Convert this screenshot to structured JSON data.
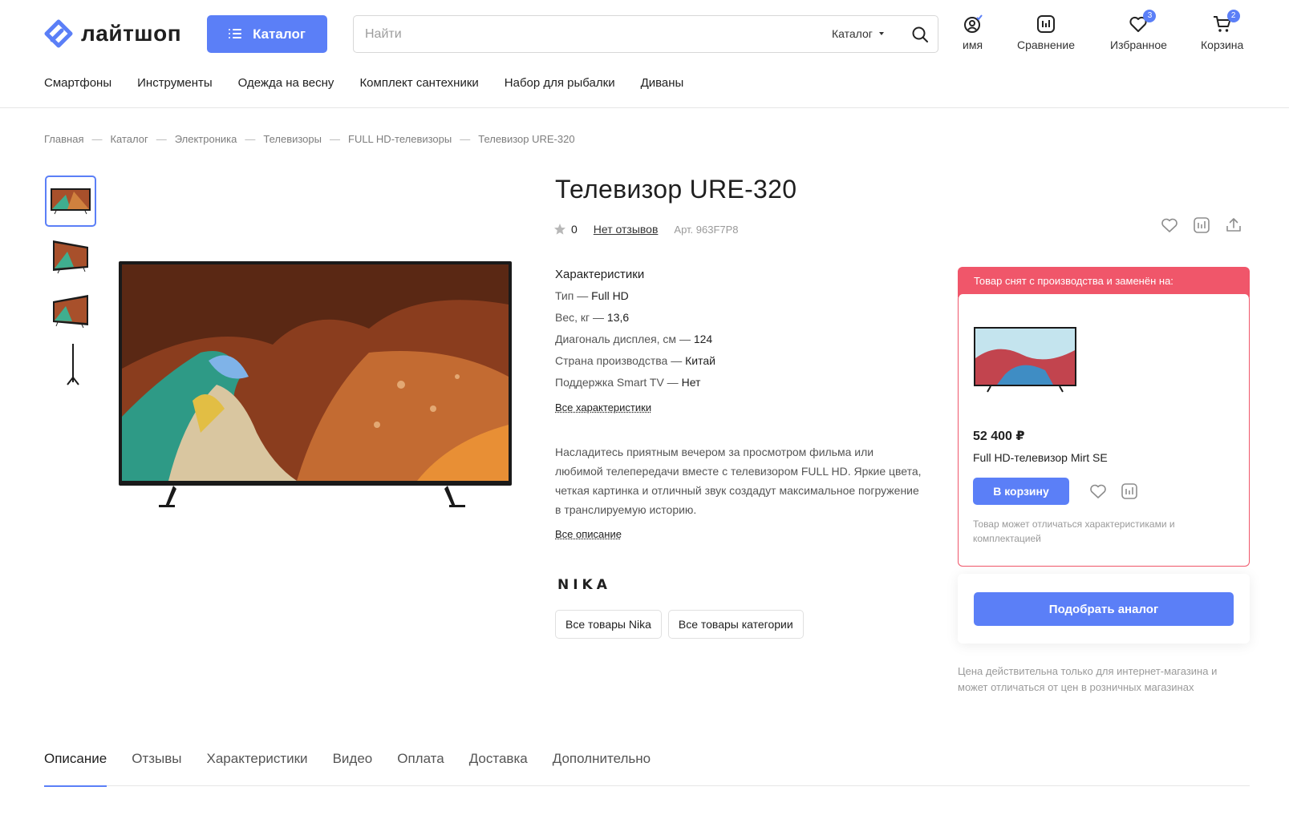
{
  "header": {
    "logo_text": "лайтшоп",
    "catalog_label": "Каталог",
    "search_placeholder": "Найти",
    "search_scope": "Каталог",
    "icons": [
      {
        "label": "имя",
        "icon": "user-icon"
      },
      {
        "label": "Сравнение",
        "icon": "compare-icon"
      },
      {
        "label": "Избранное",
        "icon": "heart-icon",
        "badge": "3"
      },
      {
        "label": "Корзина",
        "icon": "cart-icon",
        "badge": "2"
      }
    ],
    "nav": [
      "Смартфоны",
      "Инструменты",
      "Одежда на весну",
      "Комплект сантехники",
      "Набор для рыбалки",
      "Диваны"
    ]
  },
  "breadcrumb": [
    "Главная",
    "Каталог",
    "Электроника",
    "Телевизоры",
    "FULL HD-телевизоры",
    "Телевизор URE-320"
  ],
  "product": {
    "title": "Телевизор URE-320",
    "rating": "0",
    "reviews_label": "Нет отзывов",
    "sku": "Арт. 963F7P8",
    "specs_heading": "Характеристики",
    "specs": [
      {
        "name": "Тип — ",
        "value": "Full HD"
      },
      {
        "name": "Вес, кг — ",
        "value": "13,6"
      },
      {
        "name": "Диагональ дисплея, см — ",
        "value": "124"
      },
      {
        "name": "Страна производства — ",
        "value": "Китай"
      },
      {
        "name": "Поддержка Smart TV — ",
        "value": "Нет"
      }
    ],
    "all_specs_label": "Все характеристики",
    "description": "Насладитесь приятным вечером за просмотром фильма или любимой телепередачи вместе с телевизором FULL HD. Яркие цвета, четкая картинка и отличный звук создадут максимальное погружение в транслируемую историю.",
    "all_description_label": "Все описание",
    "brand_logo_text": "NIKA",
    "brand_buttons": [
      "Все товары Nika",
      "Все товары категории"
    ]
  },
  "replacement": {
    "alert": "Товар снят с производства и заменён на:",
    "price": "52 400 ₽",
    "name": "Full HD-телевизор Mirt SE",
    "cart_label": "В корзину",
    "note": "Товар может отличаться характеристиками и комплектацией"
  },
  "analog_label": "Подобрать аналог",
  "price_note": "Цена действительна только для интернет-магазина и может отличаться от цен в розничных магазинах",
  "tabs": [
    "Описание",
    "Отзывы",
    "Характеристики",
    "Видео",
    "Оплата",
    "Доставка",
    "Дополнительно"
  ],
  "colors": {
    "accent": "#5b7ff7",
    "alert": "#f0566a"
  }
}
